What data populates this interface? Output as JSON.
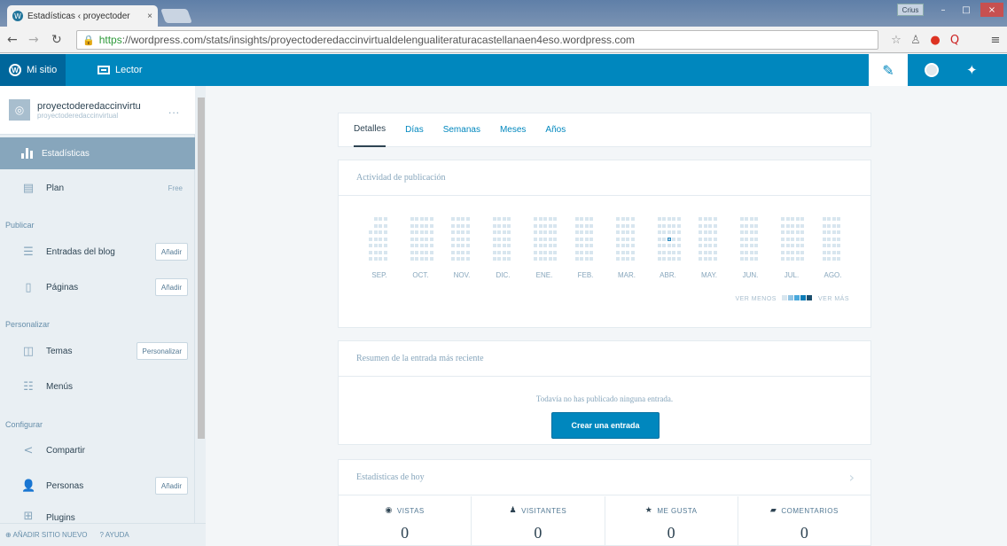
{
  "browser": {
    "tab_title": "Estadísticas ‹ proyectoder",
    "tab_close": "×",
    "user_chip": "Crius",
    "window_controls": [
      "–",
      "□",
      "×"
    ],
    "url_https": "https",
    "url_rest": "://wordpress.com/stats/insights/proyectoderedaccinvirtualdelengualiteraturacastellanaen4eso.wordpress.com"
  },
  "masterbar": {
    "my_site_label": "Mi sitio",
    "reader_label": "Lector"
  },
  "sidebar": {
    "site_name": "proyectoderedaccinvirtu",
    "site_url": "proyectoderedaccinvirtual",
    "site_more": "...",
    "active_item": "Estadísticas",
    "plan": {
      "label": "Plan",
      "badge": "Free"
    },
    "sections": {
      "publish": "Publicar",
      "personalize": "Personalizar",
      "configure": "Configurar"
    },
    "items": [
      {
        "label": "Entradas del blog",
        "button": "Añadir"
      },
      {
        "label": "Páginas",
        "button": "Añadir"
      },
      {
        "label": "Temas",
        "button": "Personalizar"
      },
      {
        "label": "Menús"
      },
      {
        "label": "Compartir"
      },
      {
        "label": "Personas",
        "button": "Añadir"
      },
      {
        "label": "Plugins"
      }
    ],
    "footer": {
      "add_site": "AÑADIR SITIO NUEVO",
      "help": "AYUDA"
    }
  },
  "stats": {
    "tabs": [
      "Detalles",
      "Días",
      "Semanas",
      "Meses",
      "Años"
    ],
    "selected_tab": 0,
    "activity": {
      "title": "Actividad de publicación",
      "months": [
        "SEP.",
        "OCT.",
        "NOV.",
        "DIC.",
        "ENE.",
        "FEB.",
        "MAR.",
        "ABR.",
        "MAY.",
        "JUN.",
        "JUL.",
        "AGO."
      ],
      "legend_less": "VER MENOS",
      "legend_more": "VER MÁS",
      "legend_colors": [
        "#d8e6ef",
        "#92c4e3",
        "#49a8dc",
        "#0b7cb7",
        "#1c4f6e"
      ]
    },
    "summary": {
      "title": "Resumen de la entrada más reciente",
      "message": "Todavía no has publicado ninguna entrada.",
      "button": "Crear una entrada"
    },
    "today": {
      "title": "Estadísticas de hoy",
      "columns": [
        {
          "label": "VISTAS",
          "icon": "eye-icon",
          "value": "0"
        },
        {
          "label": "VISITANTES",
          "icon": "person-icon",
          "value": "0"
        },
        {
          "label": "ME GUSTA",
          "icon": "star-icon",
          "value": "0"
        },
        {
          "label": "COMENTARIOS",
          "icon": "comment-icon",
          "value": "0"
        }
      ]
    }
  }
}
